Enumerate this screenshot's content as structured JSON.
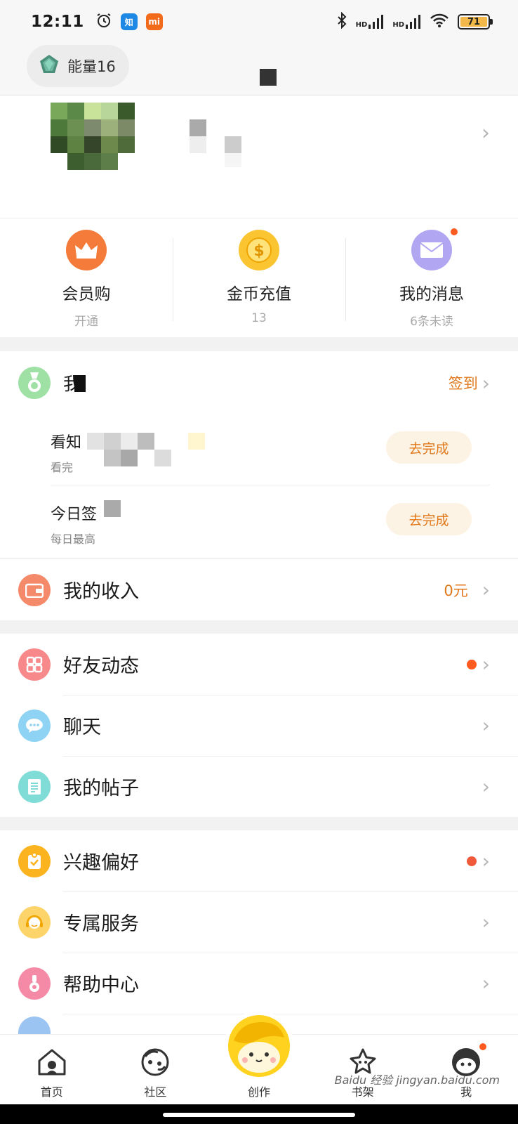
{
  "status_bar": {
    "time": "12:11",
    "app_badge_zhihu": "知",
    "app_badge_mi": "mi",
    "signal_1": "HD",
    "signal_2": "HD",
    "battery": "71"
  },
  "header": {
    "energy_label": "能量16"
  },
  "quick_actions": [
    {
      "label": "会员购",
      "sub": "开通",
      "color": "#f47b3a",
      "icon": "crown-icon"
    },
    {
      "label": "金币充值",
      "sub": "13",
      "color": "#fbc531",
      "icon": "coin-icon"
    },
    {
      "label": "我的消息",
      "sub": "6条未读",
      "color": "#a99cf0",
      "icon": "mail-icon"
    }
  ],
  "checkin": {
    "label": "我",
    "action": "签到"
  },
  "tasks": [
    {
      "title": "看知",
      "sub": "看完",
      "button": "去完成"
    },
    {
      "title": "今日签",
      "sub": "每日最高",
      "button": "去完成"
    }
  ],
  "income": {
    "label": "我的收入",
    "value": "0元"
  },
  "group_social": {
    "friends": "好友动态",
    "chat": "聊天",
    "posts": "我的帖子"
  },
  "group_settings": {
    "interests": "兴趣偏好",
    "service": "专属服务",
    "help": "帮助中心"
  },
  "tabbar": {
    "home": "首页",
    "community": "社区",
    "create": "创作",
    "bookshelf": "书架",
    "me": "我"
  },
  "watermark": "Baidu 经验 jingyan.baidu.com",
  "colors": {
    "accent_orange": "#e0781c",
    "notify_red": "#ff5a1f",
    "yellow": "#ffd21f"
  }
}
